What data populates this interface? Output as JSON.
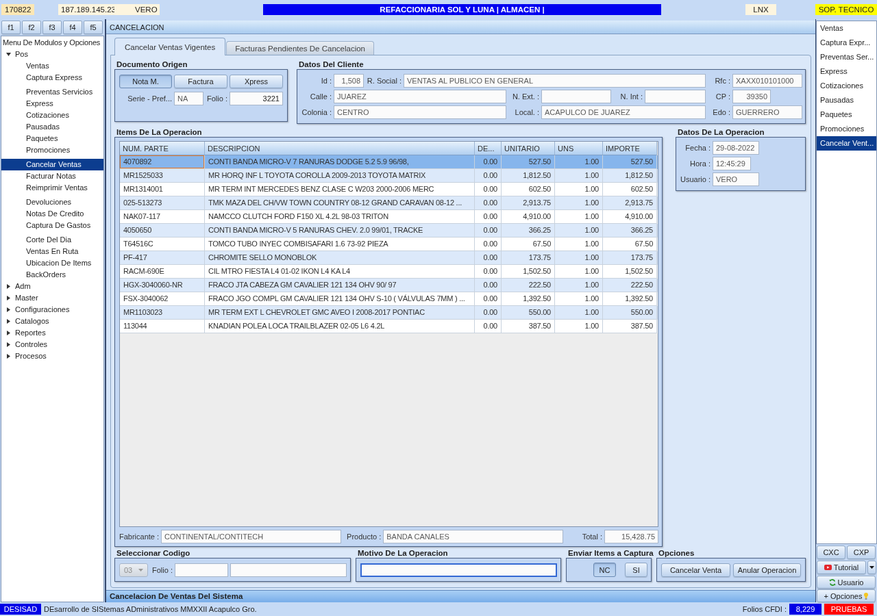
{
  "top_bar": {
    "date": "170822",
    "ip": "187.189.145.23",
    "user": "VERO",
    "title": "REFACCIONARIA SOL Y LUNA | ALMACEN |",
    "system": "LNX",
    "role": "SOP. TECNICO"
  },
  "function_keys": [
    "f1",
    "f2",
    "f3",
    "f4",
    "f5"
  ],
  "sidebar": {
    "title": "Menu De Modulos y Opciones",
    "items": [
      {
        "label": "Pos",
        "expanded": true,
        "groups": [
          {
            "children": [
              {
                "label": "Ventas",
                "selected": false
              },
              {
                "label": "Captura Express",
                "selected": false
              }
            ]
          },
          {
            "children": [
              {
                "label": "Preventas Servicios",
                "selected": false
              },
              {
                "label": "Express",
                "selected": false
              },
              {
                "label": "Cotizaciones",
                "selected": false
              },
              {
                "label": "Pausadas",
                "selected": false
              },
              {
                "label": "Paquetes",
                "selected": false
              },
              {
                "label": "Promociones",
                "selected": false
              }
            ]
          },
          {
            "children": [
              {
                "label": "Cancelar Ventas",
                "selected": true
              },
              {
                "label": "Facturar Notas",
                "selected": false
              },
              {
                "label": "Reimprimir Ventas",
                "selected": false
              }
            ]
          },
          {
            "children": [
              {
                "label": "Devoluciones",
                "selected": false
              },
              {
                "label": "Notas De Credito",
                "selected": false
              },
              {
                "label": "Captura De Gastos",
                "selected": false
              }
            ]
          },
          {
            "children": [
              {
                "label": "Corte Del Dia",
                "selected": false
              },
              {
                "label": "Ventas En Ruta",
                "selected": false
              },
              {
                "label": "Ubicacion De Items",
                "selected": false
              },
              {
                "label": "BackOrders",
                "selected": false
              }
            ]
          }
        ]
      },
      {
        "label": "Adm",
        "expanded": false
      },
      {
        "label": "Master",
        "expanded": false
      },
      {
        "label": "Configuraciones",
        "expanded": false
      },
      {
        "label": "Catalogos",
        "expanded": false
      },
      {
        "label": "Reportes",
        "expanded": false
      },
      {
        "label": "Controles",
        "expanded": false
      },
      {
        "label": "Procesos",
        "expanded": false
      }
    ]
  },
  "panel": {
    "title": "CANCELACION",
    "tabs": [
      {
        "label": "Cancelar Ventas Vigentes",
        "selected": true
      },
      {
        "label": "Facturas Pendientes De Cancelacion",
        "selected": false
      }
    ],
    "footer": "Cancelacion De Ventas Del Sistema"
  },
  "documento_origen": {
    "title": "Documento Origen",
    "types": [
      {
        "label": "Nota M.",
        "selected": true
      },
      {
        "label": "Factura",
        "selected": false
      },
      {
        "label": "Xpress",
        "selected": false
      }
    ],
    "serie": {
      "label": "Serie - Pref...",
      "value": "NA"
    },
    "folio": {
      "label": "Folio :",
      "value": "3221"
    }
  },
  "datos_cliente": {
    "title": "Datos Del Cliente",
    "id": {
      "label": "Id :",
      "value": "1,508"
    },
    "r_social": {
      "label": "R. Social :",
      "value": "VENTAS AL PUBLICO EN GENERAL"
    },
    "rfc": {
      "label": "Rfc :",
      "value": "XAXX010101000"
    },
    "calle": {
      "label": "Calle :",
      "value": "JUAREZ"
    },
    "n_ext": {
      "label": "N. Ext. :"
    },
    "n_int": {
      "label": "N. Int :"
    },
    "cp": {
      "label": "CP :",
      "value": "39350"
    },
    "colonia": {
      "label": "Colonia :",
      "value": "CENTRO"
    },
    "localidad": {
      "label": "Local. :",
      "value": "ACAPULCO DE JUAREZ"
    },
    "edo": {
      "label": "Edo :",
      "value": "GUERRERO"
    }
  },
  "items": {
    "title": "Items De La Operacion",
    "columns": [
      "NUM. PARTE",
      "DESCRIPCION",
      "DE...",
      "UNITARIO",
      "UNS",
      "IMPORTE"
    ],
    "rows": [
      {
        "cells": [
          "4070892",
          "CONTI BANDA MICRO-V 7 RANURAS DODGE 5.2 5.9 96/98,",
          "0.00",
          "527.50",
          "1.00",
          "527.50"
        ],
        "selected": true
      },
      {
        "cells": [
          "MR1525033",
          "MR HORQ INF L TOYOTA COROLLA 2009-2013 TOYOTA MATRIX",
          "0.00",
          "1,812.50",
          "1.00",
          "1,812.50"
        ],
        "selected": false
      },
      {
        "cells": [
          "MR1314001",
          "MR TERM INT MERCEDES BENZ CLASE C W203 2000-2006 MERC",
          "0.00",
          "602.50",
          "1.00",
          "602.50"
        ],
        "selected": false
      },
      {
        "cells": [
          "025-513273",
          "TMK MAZA DEL CH/VW TOWN COUNTRY 08-12 GRAND CARAVAN 08-12 ...",
          "0.00",
          "2,913.75",
          "1.00",
          "2,913.75"
        ],
        "selected": false
      },
      {
        "cells": [
          "NAK07-117",
          "NAMCCO CLUTCH FORD F150 XL 4.2L 98-03 TRITON",
          "0.00",
          "4,910.00",
          "1.00",
          "4,910.00"
        ],
        "selected": false
      },
      {
        "cells": [
          "4050650",
          "CONTI BANDA MICRO-V 5 RANURAS CHEV. 2.0 99/01, TRACKE",
          "0.00",
          "366.25",
          "1.00",
          "366.25"
        ],
        "selected": false
      },
      {
        "cells": [
          "T64516C",
          "TOMCO TUBO INYEC COMBISAFARI 1.6 73-92 PIEZA",
          "0.00",
          "67.50",
          "1.00",
          "67.50"
        ],
        "selected": false
      },
      {
        "cells": [
          "PF-417",
          "CHROMITE SELLO MONOBLOK",
          "0.00",
          "173.75",
          "1.00",
          "173.75"
        ],
        "selected": false
      },
      {
        "cells": [
          "RACM-690E",
          "CIL MTRO FIESTA L4 01-02 IKON L4 KA L4",
          "0.00",
          "1,502.50",
          "1.00",
          "1,502.50"
        ],
        "selected": false
      },
      {
        "cells": [
          "HGX-3040060-NR",
          "FRACO JTA CABEZA GM CAVALIER 121 134 OHV 90/ 97",
          "0.00",
          "222.50",
          "1.00",
          "222.50"
        ],
        "selected": false
      },
      {
        "cells": [
          "FSX-3040062",
          "FRACO JGO COMPL GM CAVALIER 121 134 OHV S-10 ( VÁLVULAS 7MM ) ...",
          "0.00",
          "1,392.50",
          "1.00",
          "1,392.50"
        ],
        "selected": false
      },
      {
        "cells": [
          "MR1103023",
          "MR TERM EXT L CHEVROLET GMC AVEO I 2008-2017 PONTIAC",
          "0.00",
          "550.00",
          "1.00",
          "550.00"
        ],
        "selected": false
      },
      {
        "cells": [
          "113044",
          "KNADIAN POLEA LOCA TRAILBLAZER 02-05 L6 4.2L",
          "0.00",
          "387.50",
          "1.00",
          "387.50"
        ],
        "selected": false
      }
    ],
    "fabricante": {
      "label": "Fabricante :",
      "value": "CONTINENTAL/CONTITECH"
    },
    "producto": {
      "label": "Producto :",
      "value": "BANDA CANALES"
    },
    "total": {
      "label": "Total :",
      "value": "15,428.75"
    }
  },
  "datos_operacion": {
    "title": "Datos De La Operacion",
    "fields": [
      {
        "label": "Fecha :",
        "value": "29-08-2022"
      },
      {
        "label": "Hora :",
        "value": "12:45:29"
      },
      {
        "label": "Usuario :",
        "value": "VERO"
      }
    ]
  },
  "seleccionar_codigo": {
    "title": "Seleccionar Codigo",
    "code": {
      "value": "03",
      "disabled": true
    },
    "folio_label": "Folio :"
  },
  "motivo": {
    "title": "Motivo De La Operacion",
    "focused": true
  },
  "enviar": {
    "title": "Enviar Items a Captura",
    "options": [
      {
        "label": "NC",
        "selected": true
      },
      {
        "label": "SI",
        "selected": false
      }
    ]
  },
  "opciones": {
    "title": "Opciones",
    "buttons": [
      "Cancelar Venta",
      "Anular Operacion"
    ]
  },
  "right_menu": {
    "items": [
      {
        "label": "Ventas",
        "selected": false
      },
      {
        "label": "Captura Expr...",
        "selected": false
      },
      {
        "label": "Preventas Ser...",
        "selected": false
      },
      {
        "label": "Express",
        "selected": false
      },
      {
        "label": "Cotizaciones",
        "selected": false
      },
      {
        "label": "Pausadas",
        "selected": false
      },
      {
        "label": "Paquetes",
        "selected": false
      },
      {
        "label": "Promociones",
        "selected": false
      },
      {
        "label": "Cancelar Vent...",
        "selected": true
      }
    ],
    "cxc": "CXC",
    "cxp": "CXP",
    "tutorial": "Tutorial",
    "usuario": "Usuario",
    "opciones": "+ Opciones"
  },
  "status_bar": {
    "app": "DESISAD",
    "text": "DEsarrollo de SIStemas ADministrativos MMXXII Acapulco Gro.",
    "folios_label": "Folios CFDI :",
    "folios": "8,229",
    "environment": "PRUEBAS"
  }
}
